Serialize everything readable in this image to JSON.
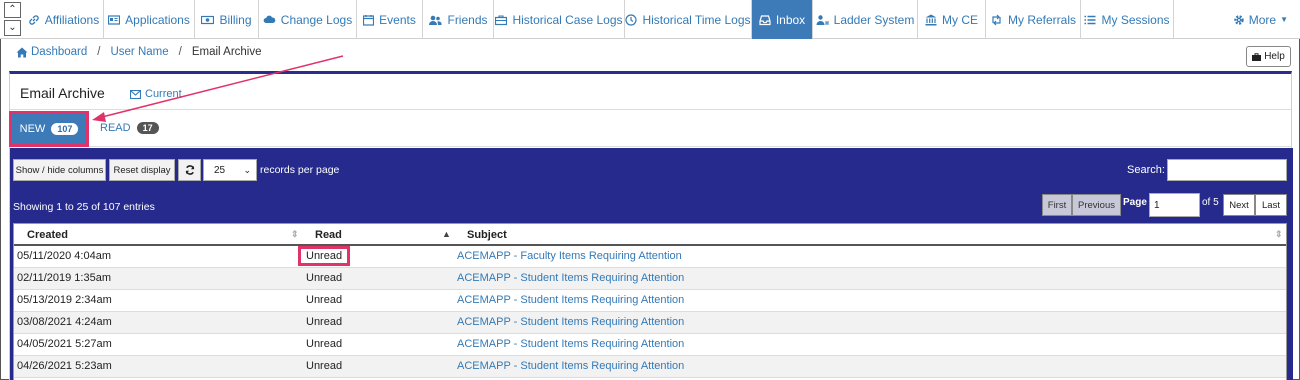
{
  "nav": {
    "tabs": [
      {
        "label": "Affiliations",
        "icon": "link-icon"
      },
      {
        "label": "Applications",
        "icon": "id-card-icon"
      },
      {
        "label": "Billing",
        "icon": "money-icon"
      },
      {
        "label": "Change Logs",
        "icon": "cloud-icon"
      },
      {
        "label": "Events",
        "icon": "calendar-icon"
      },
      {
        "label": "Friends",
        "icon": "users-icon"
      },
      {
        "label": "Historical Case Logs",
        "icon": "briefcase-icon"
      },
      {
        "label": "Historical Time Logs",
        "icon": "clock-icon"
      },
      {
        "label": "Inbox",
        "icon": "inbox-icon"
      },
      {
        "label": "Ladder System",
        "icon": "user-ladder-icon"
      },
      {
        "label": "My CE",
        "icon": "institution-icon"
      },
      {
        "label": "My Referrals",
        "icon": "retweet-icon"
      },
      {
        "label": "My Sessions",
        "icon": "list-icon"
      }
    ],
    "more_label": "More",
    "active_color": "#3d7ab8"
  },
  "breadcrumb": {
    "dashboard": "Dashboard",
    "user": "User Name",
    "current": "Email Archive"
  },
  "help_label": "Help",
  "panel": {
    "title": "Email Archive",
    "current_link": "Current"
  },
  "subtabs": {
    "new_label": "NEW",
    "new_count": "107",
    "read_label": "READ",
    "read_count": "17"
  },
  "toolbar": {
    "show_hide_columns": "Show / hide columns",
    "reset_display": "Reset display",
    "page_size": "25",
    "records_per_page": "records per page",
    "search_label": "Search:",
    "search_value": ""
  },
  "info": {
    "showing": "Showing 1 to 25 of 107 entries"
  },
  "pagination": {
    "first": "First",
    "previous": "Previous",
    "page_label": "Page",
    "page_value": "1",
    "of_label": "of 5",
    "next": "Next",
    "last": "Last"
  },
  "table": {
    "headers": {
      "created": "Created",
      "read": "Read",
      "subject": "Subject"
    },
    "rows": [
      {
        "created": "05/11/2020 4:04am",
        "read": "Unread",
        "subject": "ACEMAPP - Faculty Items Requiring Attention"
      },
      {
        "created": "02/11/2019 1:35am",
        "read": "Unread",
        "subject": "ACEMAPP - Student Items Requiring Attention"
      },
      {
        "created": "05/13/2019 2:34am",
        "read": "Unread",
        "subject": "ACEMAPP - Student Items Requiring Attention"
      },
      {
        "created": "03/08/2021 4:24am",
        "read": "Unread",
        "subject": "ACEMAPP - Student Items Requiring Attention"
      },
      {
        "created": "04/05/2021 5:27am",
        "read": "Unread",
        "subject": "ACEMAPP - Student Items Requiring Attention"
      },
      {
        "created": "04/26/2021 5:23am",
        "read": "Unread",
        "subject": "ACEMAPP - Student Items Requiring Attention"
      }
    ]
  },
  "colors": {
    "blue_area": "#252a8c",
    "link": "#337ab7",
    "annotation": "#e0336a"
  }
}
